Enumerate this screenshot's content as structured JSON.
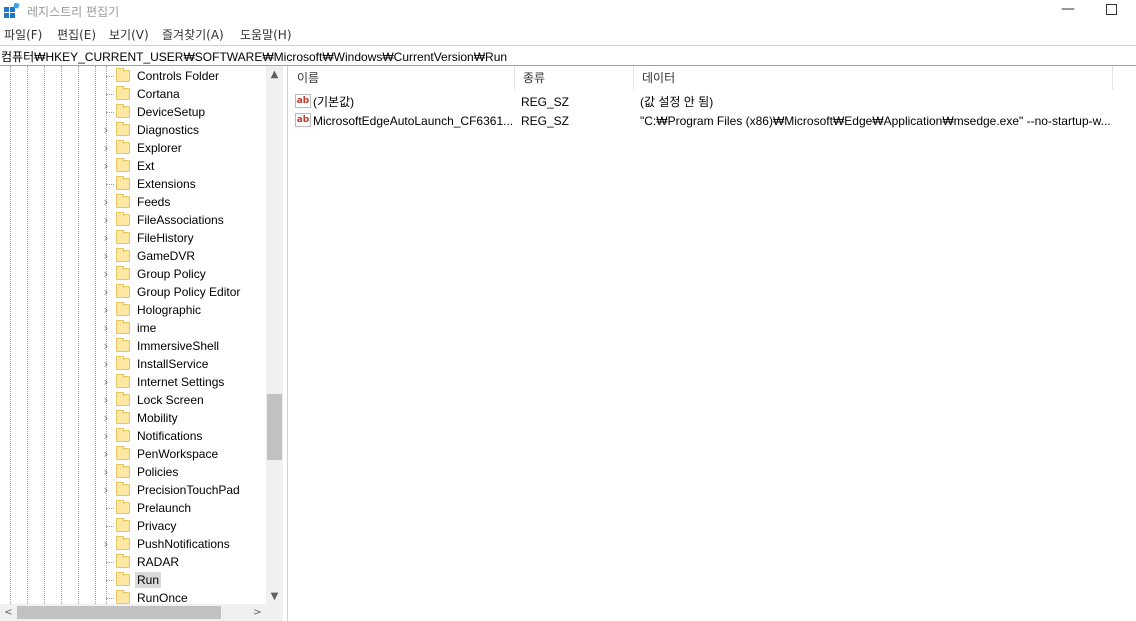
{
  "window": {
    "title": "레지스트리 편집기",
    "minimize_glyph": "—"
  },
  "menu": [
    "파일(F)",
    "편집(E)",
    "보기(V)",
    "즐겨찾기(A)",
    "도움말(H)"
  ],
  "address": "컴퓨터₩HKEY_CURRENT_USER₩SOFTWARE₩Microsoft₩Windows₩CurrentVersion₩Run",
  "tree": {
    "items": [
      {
        "label": "Controls Folder",
        "expandable": false,
        "selected": false
      },
      {
        "label": "Cortana",
        "expandable": false,
        "selected": false
      },
      {
        "label": "DeviceSetup",
        "expandable": false,
        "selected": false
      },
      {
        "label": "Diagnostics",
        "expandable": true,
        "selected": false
      },
      {
        "label": "Explorer",
        "expandable": true,
        "selected": false
      },
      {
        "label": "Ext",
        "expandable": true,
        "selected": false
      },
      {
        "label": "Extensions",
        "expandable": false,
        "selected": false
      },
      {
        "label": "Feeds",
        "expandable": true,
        "selected": false
      },
      {
        "label": "FileAssociations",
        "expandable": true,
        "selected": false
      },
      {
        "label": "FileHistory",
        "expandable": true,
        "selected": false
      },
      {
        "label": "GameDVR",
        "expandable": true,
        "selected": false
      },
      {
        "label": "Group Policy",
        "expandable": true,
        "selected": false
      },
      {
        "label": "Group Policy Editor",
        "expandable": true,
        "selected": false
      },
      {
        "label": "Holographic",
        "expandable": true,
        "selected": false
      },
      {
        "label": "ime",
        "expandable": true,
        "selected": false
      },
      {
        "label": "ImmersiveShell",
        "expandable": true,
        "selected": false
      },
      {
        "label": "InstallService",
        "expandable": true,
        "selected": false
      },
      {
        "label": "Internet Settings",
        "expandable": true,
        "selected": false
      },
      {
        "label": "Lock Screen",
        "expandable": true,
        "selected": false
      },
      {
        "label": "Mobility",
        "expandable": true,
        "selected": false
      },
      {
        "label": "Notifications",
        "expandable": true,
        "selected": false
      },
      {
        "label": "PenWorkspace",
        "expandable": true,
        "selected": false
      },
      {
        "label": "Policies",
        "expandable": true,
        "selected": false
      },
      {
        "label": "PrecisionTouchPad",
        "expandable": true,
        "selected": false
      },
      {
        "label": "Prelaunch",
        "expandable": false,
        "selected": false
      },
      {
        "label": "Privacy",
        "expandable": false,
        "selected": false
      },
      {
        "label": "PushNotifications",
        "expandable": true,
        "selected": false
      },
      {
        "label": "RADAR",
        "expandable": false,
        "selected": false
      },
      {
        "label": "Run",
        "expandable": false,
        "selected": true
      },
      {
        "label": "RunOnce",
        "expandable": false,
        "selected": false
      }
    ]
  },
  "scroll_glyphs": {
    "up": "▲",
    "down": "▼",
    "left": "<",
    "right": ">"
  },
  "list": {
    "columns": [
      "이름",
      "종류",
      "데이터"
    ],
    "rows": [
      {
        "icon": "ab",
        "name": "(기본값)",
        "type": "REG_SZ",
        "data": "(값 설정 안 됨)"
      },
      {
        "icon": "ab",
        "name": "MicrosoftEdgeAutoLaunch_CF6361...",
        "type": "REG_SZ",
        "data": "\"C:₩Program Files (x86)₩Microsoft₩Edge₩Application₩msedge.exe\" --no-startup-w..."
      }
    ]
  },
  "colors": {
    "folder": "#ffe8a3",
    "selected_bg": "#d9d9d9",
    "scroll_thumb": "#c1c1c1",
    "title_text": "#9a9a9a",
    "string_icon": "#c0392b"
  }
}
